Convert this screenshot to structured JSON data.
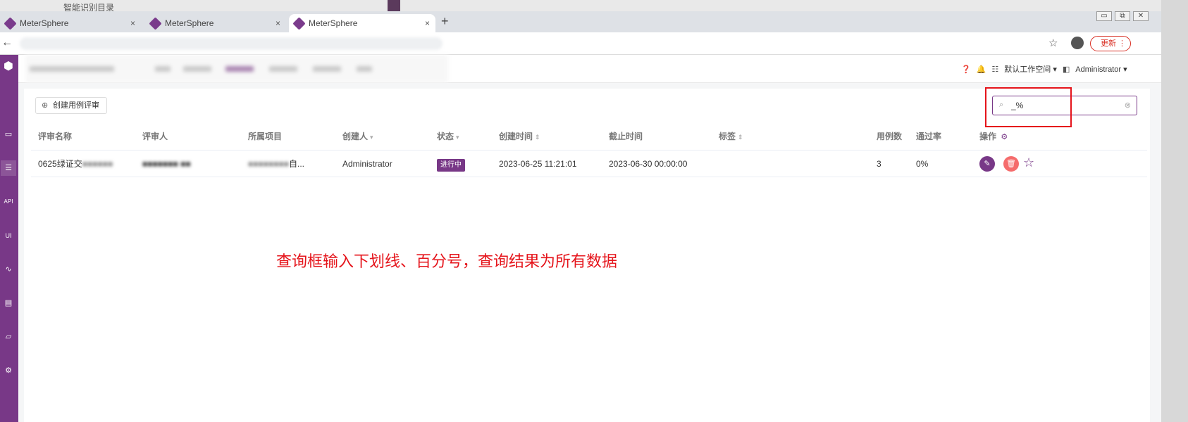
{
  "browser": {
    "tabs": [
      {
        "label": "MeterSphere",
        "active": false
      },
      {
        "label": "MeterSphere",
        "active": false
      },
      {
        "label": "MeterSphere",
        "active": true
      }
    ],
    "background_tab_label": "智能识别目录",
    "new_tab_label": "+",
    "close_glyph": "×",
    "update_label": "更新",
    "window_controls": [
      "▭",
      "⧉",
      "✕"
    ]
  },
  "header": {
    "workspace_label": "默认工作空间",
    "user_label": "Administrator"
  },
  "toolbar": {
    "create_label": "创建用例评审",
    "search_value": "_%"
  },
  "table": {
    "columns": [
      "评审名称",
      "评审人",
      "所属项目",
      "创建人",
      "状态",
      "创建时间",
      "截止时间",
      "标签",
      "用例数",
      "通过率",
      "操作"
    ],
    "rows": [
      {
        "name": "0625绿证交",
        "reviewer": "",
        "project_suffix": "自...",
        "creator": "Administrator",
        "status": "进行中",
        "created_at": "2023-06-25 11:21:01",
        "deadline": "2023-06-30 00:00:00",
        "tags": "",
        "case_count": "3",
        "pass_rate": "0%"
      }
    ]
  },
  "annotation": {
    "text": "查询框输入下划线、百分号，查询结果为所有数据",
    "color": "#e5141b"
  },
  "colors": {
    "brand": "#783887",
    "danger": "#f56c6c",
    "annotation_red": "#e5141b"
  }
}
